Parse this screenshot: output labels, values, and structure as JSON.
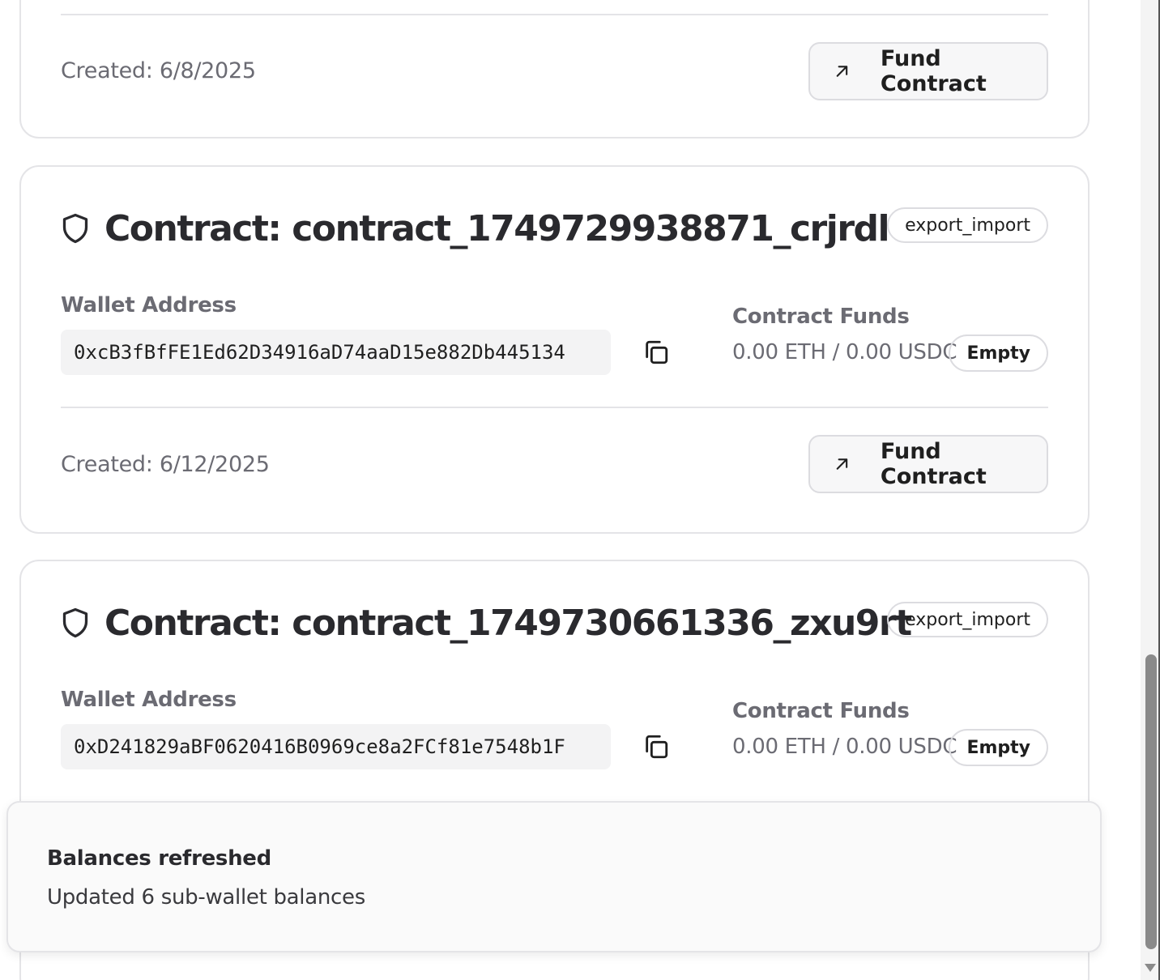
{
  "contracts": [
    {
      "created": "Created: 6/8/2025",
      "fund_label": "Fund Contract"
    },
    {
      "title": "Contract: contract_1749729938871_crjrdl",
      "badge": "export_import",
      "wallet_label": "Wallet Address",
      "wallet_address": "0xcB3fBfFE1Ed62D34916aD74aaD15e882Db445134",
      "funds_label": "Contract Funds",
      "funds_value": "0.00 ETH / 0.00 USDC",
      "funds_status": "Empty",
      "created": "Created: 6/12/2025",
      "fund_label": "Fund Contract"
    },
    {
      "title": "Contract: contract_1749730661336_zxu9rt",
      "badge": "export_import",
      "wallet_label": "Wallet Address",
      "wallet_address": "0xD241829aBF0620416B0969ce8a2FCf81e7548b1F",
      "funds_label": "Contract Funds",
      "funds_value": "0.00 ETH / 0.00 USDC",
      "funds_status": "Empty"
    }
  ],
  "toast": {
    "title": "Balances refreshed",
    "description": "Updated 6 sub-wallet balances"
  },
  "icons": {
    "shield": "shield-icon",
    "copy": "copy-icon",
    "arrow": "arrow-up-right-icon"
  }
}
